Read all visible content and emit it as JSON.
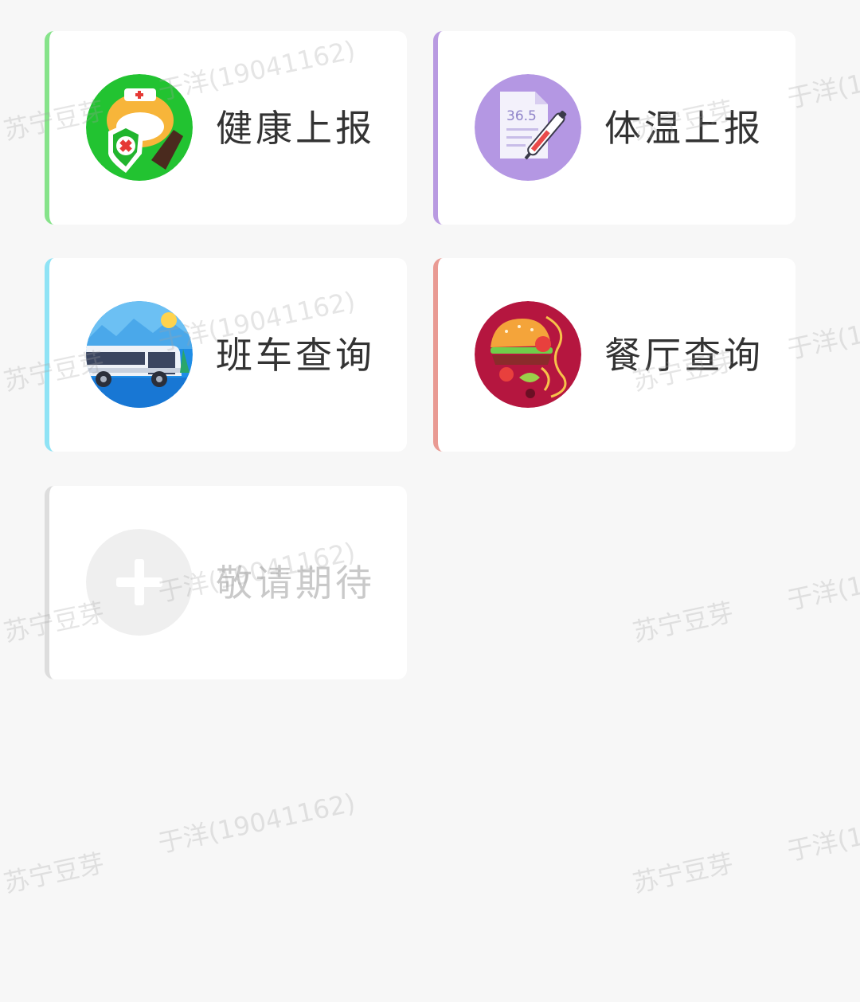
{
  "cards": [
    {
      "id": "health",
      "label": "健康上报",
      "icon": "health-mask-icon",
      "accent": "#86e38a",
      "enabled": true
    },
    {
      "id": "temp",
      "label": "体温上报",
      "icon": "thermometer-icon",
      "accent": "#b99ae1",
      "enabled": true
    },
    {
      "id": "bus",
      "label": "班车查询",
      "icon": "bus-icon",
      "accent": "#8fe3f5",
      "enabled": true
    },
    {
      "id": "rest",
      "label": "餐厅查询",
      "icon": "burger-icon",
      "accent": "#e99a93",
      "enabled": true
    },
    {
      "id": "soon",
      "label": "敬请期待",
      "icon": "plus-icon",
      "accent": "#dddddd",
      "enabled": false
    }
  ],
  "temp_icon_text": "36.5",
  "watermark": {
    "user": "于洋(19041162)",
    "company": "苏宁豆芽"
  },
  "colors": {
    "background": "#f7f7f7",
    "card": "#ffffff",
    "text": "#333333",
    "disabled_text": "#c9c9c9"
  }
}
